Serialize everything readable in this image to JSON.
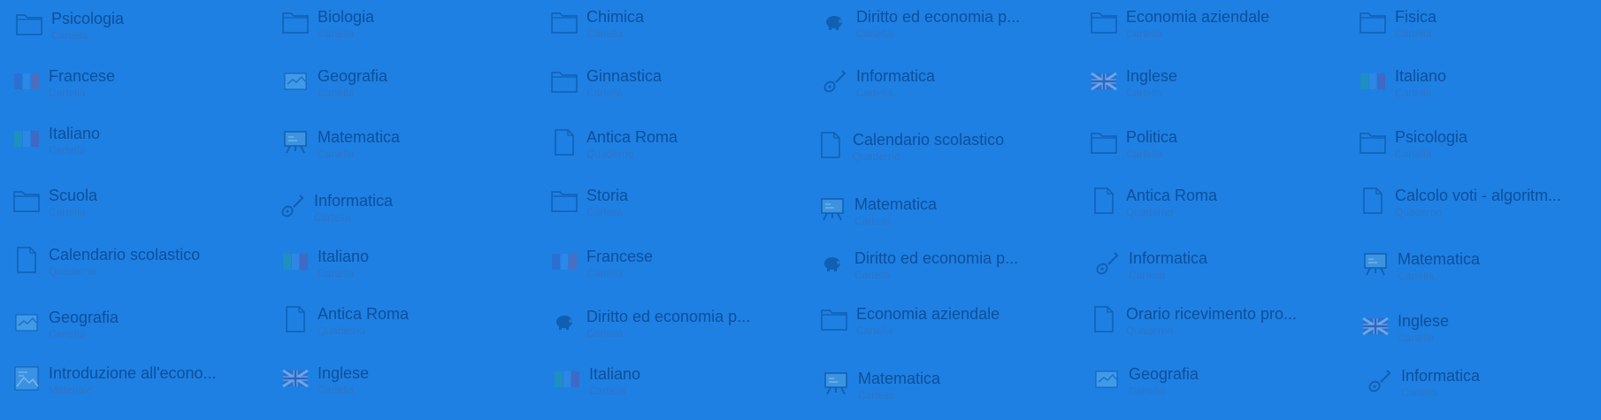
{
  "items": [
    {
      "label": "Psicologia",
      "sub": "Cartella",
      "icon": "folder-icon"
    },
    {
      "label": "Biologia",
      "sub": "Cartella",
      "icon": "folder-icon"
    },
    {
      "label": "Chimica",
      "sub": "Cartella",
      "icon": "folder-icon"
    },
    {
      "label": "Diritto ed economia p...",
      "sub": "Cartella",
      "icon": "piggy-bank-icon"
    },
    {
      "label": "Economia aziendale",
      "sub": "Cartella",
      "icon": "folder-icon"
    },
    {
      "label": "Fisica",
      "sub": "Cartella",
      "icon": "folder-icon"
    },
    {
      "label": "Francese",
      "sub": "Cartella",
      "icon": "flag-france-icon"
    },
    {
      "label": "Geografia",
      "sub": "Cartella",
      "icon": "map-icon"
    },
    {
      "label": "Ginnastica",
      "sub": "Cartella",
      "icon": "folder-icon"
    },
    {
      "label": "Informatica",
      "sub": "Cartella",
      "icon": "guitar-icon"
    },
    {
      "label": "Inglese",
      "sub": "Cartella",
      "icon": "flag-uk-icon"
    },
    {
      "label": "Italiano",
      "sub": "Cartella",
      "icon": "flag-italy-icon"
    },
    {
      "label": "Italiano",
      "sub": "Cartella",
      "icon": "flag-italy-icon"
    },
    {
      "label": "Matematica",
      "sub": "Cartella",
      "icon": "blackboard-icon"
    },
    {
      "label": "Antica Roma",
      "sub": "Quaderno",
      "icon": "document-icon"
    },
    {
      "label": "Calendario scolastico",
      "sub": "Quaderno",
      "icon": "document-icon"
    },
    {
      "label": "Politica",
      "sub": "Cartella",
      "icon": "folder-icon"
    },
    {
      "label": "Psicologia",
      "sub": "Cartella",
      "icon": "folder-icon"
    },
    {
      "label": "Scuola",
      "sub": "Cartella",
      "icon": "folder-icon"
    },
    {
      "label": "Informatica",
      "sub": "Cartella",
      "icon": "guitar-icon"
    },
    {
      "label": "Storia",
      "sub": "Cartella",
      "icon": "folder-icon"
    },
    {
      "label": "Matematica",
      "sub": "Cartella",
      "icon": "blackboard-icon"
    },
    {
      "label": "Antica Roma",
      "sub": "Quaderno",
      "icon": "document-icon"
    },
    {
      "label": "Calcolo voti - algoritm...",
      "sub": "Quaderno",
      "icon": "document-icon"
    },
    {
      "label": "Calendario scolastico",
      "sub": "Quaderno",
      "icon": "document-icon"
    },
    {
      "label": "Italiano",
      "sub": "Cartella",
      "icon": "flag-italy-icon"
    },
    {
      "label": "Francese",
      "sub": "Cartella",
      "icon": "flag-france-icon"
    },
    {
      "label": "Diritto ed economia p...",
      "sub": "Cartella",
      "icon": "piggy-bank-icon"
    },
    {
      "label": "Informatica",
      "sub": "Cartella",
      "icon": "guitar-icon"
    },
    {
      "label": "Matematica",
      "sub": "Cartella",
      "icon": "blackboard-icon"
    },
    {
      "label": "Geografia",
      "sub": "Cartella",
      "icon": "map-icon"
    },
    {
      "label": "Antica Roma",
      "sub": "Quaderno",
      "icon": "document-icon"
    },
    {
      "label": "Diritto ed economia p...",
      "sub": "Cartella",
      "icon": "piggy-bank-icon"
    },
    {
      "label": "Economia aziendale",
      "sub": "Cartella",
      "icon": "folder-icon"
    },
    {
      "label": "Orario ricevimento pro...",
      "sub": "Quaderno",
      "icon": "document-icon"
    },
    {
      "label": "Inglese",
      "sub": "Cartella",
      "icon": "flag-uk-icon"
    },
    {
      "label": "Introduzione all'econo...",
      "sub": "Materiale",
      "icon": "image-icon"
    },
    {
      "label": "Inglese",
      "sub": "Cartella",
      "icon": "flag-uk-icon"
    },
    {
      "label": "Italiano",
      "sub": "Cartella",
      "icon": "flag-italy-icon"
    },
    {
      "label": "Matematica",
      "sub": "Cartella",
      "icon": "blackboard-icon"
    },
    {
      "label": "Geografia",
      "sub": "Cartella",
      "icon": "map-icon"
    },
    {
      "label": "Informatica",
      "sub": "Cartella",
      "icon": "guitar-icon"
    }
  ]
}
